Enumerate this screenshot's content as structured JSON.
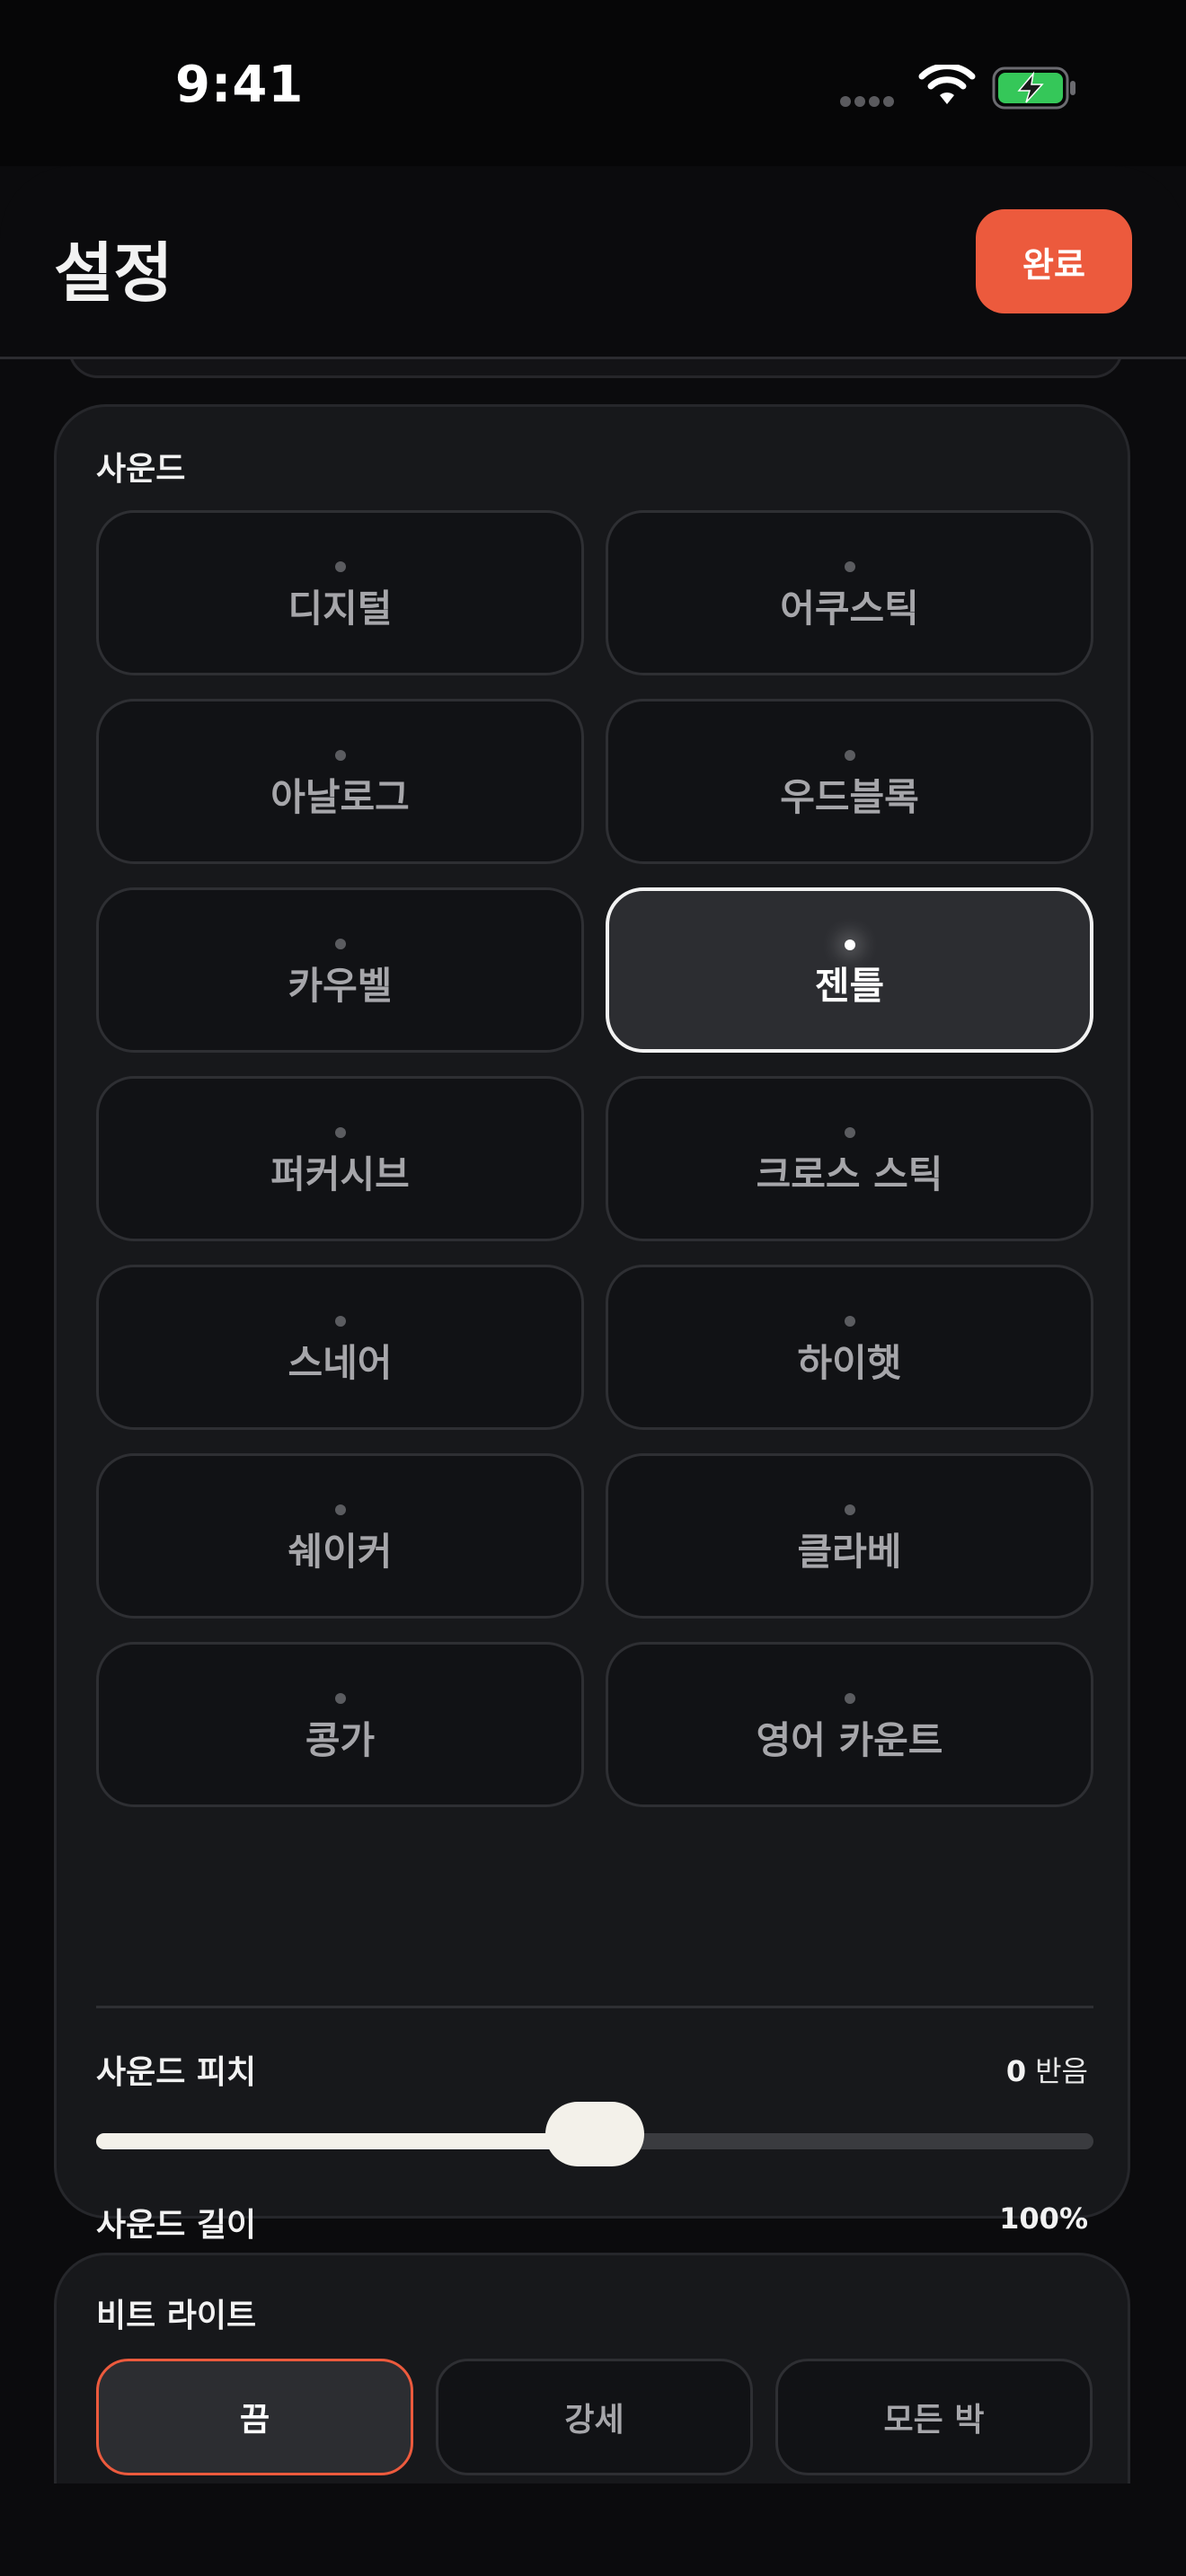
{
  "status_bar": {
    "time": "9:41",
    "signal_icon": "signal-dots-icon",
    "wifi_icon": "wifi-icon",
    "battery_icon": "battery-charging-icon",
    "battery_color": "#35c759"
  },
  "header": {
    "title": "설정",
    "done_label": "완료",
    "accent_color": "#ec5a3d"
  },
  "sound": {
    "section_title": "사운드",
    "selected": "젠틀",
    "options": [
      "디지털",
      "어쿠스틱",
      "아날로그",
      "우드블록",
      "카우벨",
      "젠틀",
      "퍼커시브",
      "크로스 스틱",
      "스네어",
      "하이햇",
      "쉐이커",
      "클라베",
      "콩가",
      "영어 카운트"
    ],
    "pitch": {
      "label": "사운드 피치",
      "value": "0",
      "unit": "반음",
      "position_fraction": 0.5
    },
    "length": {
      "label": "사운드 길이",
      "value": "100%",
      "position_fraction": 0.5
    }
  },
  "beat_light": {
    "section_title": "비트 라이트",
    "options": [
      "끔",
      "강세",
      "모든 박"
    ],
    "selected": "끔"
  }
}
